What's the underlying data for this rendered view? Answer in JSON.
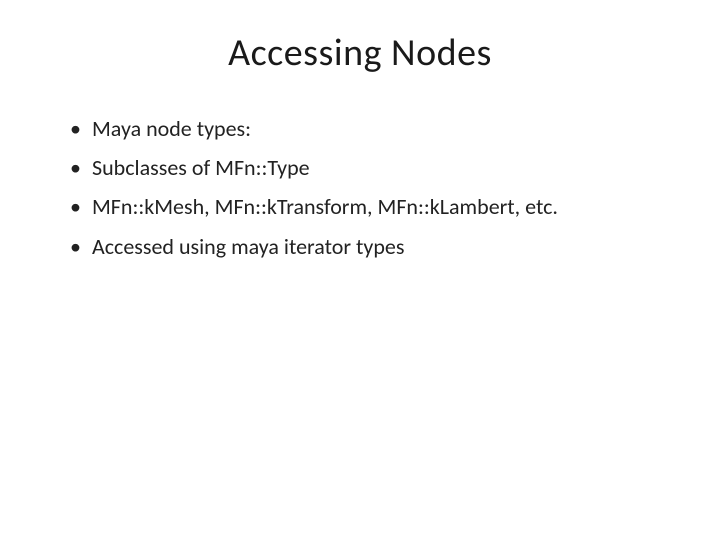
{
  "slide": {
    "title": "Accessing Nodes",
    "bullets": [
      "Maya node types:",
      "Subclasses of MFn::Type",
      "MFn::kMesh, MFn::kTransform, MFn::kLambert, etc.",
      "Accessed using maya iterator types"
    ]
  }
}
